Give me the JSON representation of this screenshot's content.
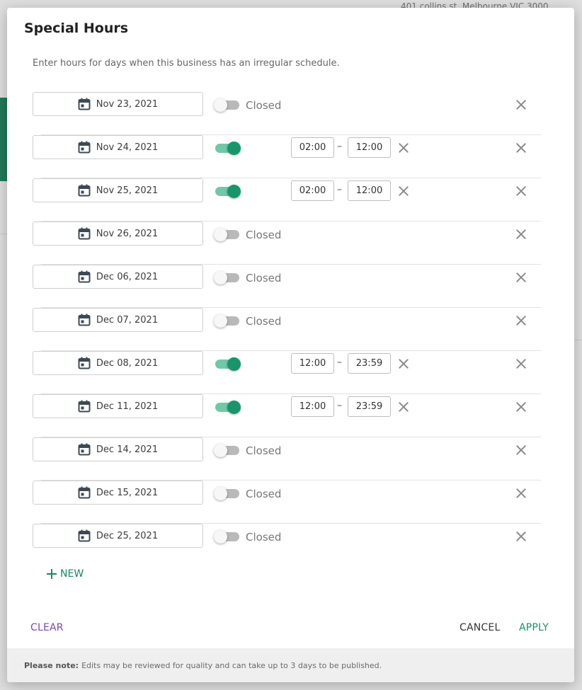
{
  "background": {
    "address": "401 collins st, Melbourne VIC 3000"
  },
  "dialog": {
    "title": "Special Hours",
    "subtitle": "Enter hours for days when this business has an irregular schedule.",
    "closed_label": "Closed",
    "time_separator": "–",
    "rows": [
      {
        "date": "Nov 23, 2021",
        "open": false
      },
      {
        "date": "Nov 24, 2021",
        "open": true,
        "start": "02:00",
        "end": "12:00"
      },
      {
        "date": "Nov 25, 2021",
        "open": true,
        "start": "02:00",
        "end": "12:00"
      },
      {
        "date": "Nov 26, 2021",
        "open": false
      },
      {
        "date": "Dec 06, 2021",
        "open": false
      },
      {
        "date": "Dec 07, 2021",
        "open": false
      },
      {
        "date": "Dec 08, 2021",
        "open": true,
        "start": "12:00",
        "end": "23:59"
      },
      {
        "date": "Dec 11, 2021",
        "open": true,
        "start": "12:00",
        "end": "23:59"
      },
      {
        "date": "Dec 14, 2021",
        "open": false
      },
      {
        "date": "Dec 15, 2021",
        "open": false
      },
      {
        "date": "Dec 25, 2021",
        "open": false
      }
    ],
    "new_label": "NEW",
    "clear_label": "CLEAR",
    "cancel_label": "CANCEL",
    "apply_label": "APPLY",
    "footer_note_label": "Please note:",
    "footer_note_text": "Edits may be reviewed for quality and can take up to 3 days to be published."
  },
  "colors": {
    "accent_green": "#149466",
    "toggle_on_track": "#6ecaa6",
    "clear_purple": "#7e44b5"
  }
}
